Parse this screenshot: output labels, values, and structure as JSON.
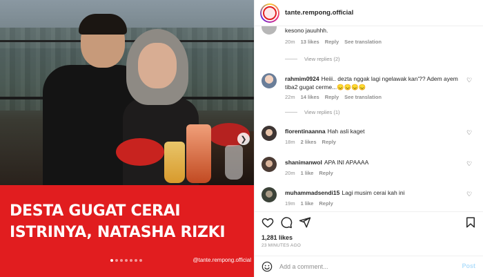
{
  "post": {
    "headline_line1": "DESTA GUGAT CERAI",
    "headline_line2": "ISTRINYA, NATASHA RIZKI",
    "watermark": "@tante.rempong.official",
    "slide_dots": 7,
    "active_dot": 0
  },
  "header": {
    "account": "tante.rempong.official"
  },
  "comments": [
    {
      "username": "",
      "text": "kesono jauuhhh.",
      "time": "20m",
      "likes": "13 likes",
      "reply": "Reply",
      "translate": "See translation",
      "view_replies": "View replies (2)"
    },
    {
      "username": "rahmim0924",
      "text": "Heiii.. dezta nggak lagi ngelawak kan'?? Adem ayem tiba2 gugat cerme...😞😞😞😞",
      "time": "22m",
      "likes": "14 likes",
      "reply": "Reply",
      "translate": "See translation",
      "view_replies": "View replies (1)"
    },
    {
      "username": "florentinaanna",
      "text": "Hah asli kaget",
      "time": "18m",
      "likes": "2 likes",
      "reply": "Reply"
    },
    {
      "username": "shanimanwol",
      "text": "APA INI APAAAA",
      "time": "20m",
      "likes": "1 like",
      "reply": "Reply"
    },
    {
      "username": "muhammadsendi15",
      "text": "Lagi musim cerai kah ini",
      "time": "19m",
      "likes": "1 like",
      "reply": "Reply"
    }
  ],
  "stats": {
    "likes": "1,281 likes",
    "time_ago": "23 MINUTES AGO"
  },
  "composer": {
    "placeholder": "Add a comment...",
    "post_label": "Post"
  },
  "icons": {
    "like": "heart-icon",
    "comment": "comment-icon",
    "share": "share-icon",
    "save": "bookmark-icon",
    "emoji": "emoji-icon",
    "next": "chevron-right-icon"
  },
  "colors": {
    "banner": "#e11d1f",
    "post_button": "#b2dffc",
    "meta_text": "#8e8e8e"
  }
}
